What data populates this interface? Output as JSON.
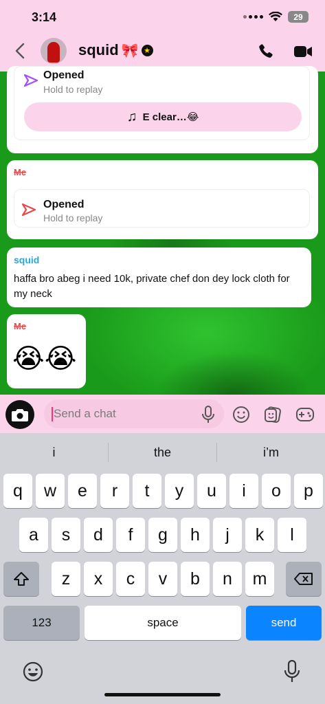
{
  "status_bar": {
    "time": "3:14",
    "battery": "29"
  },
  "header": {
    "contact_name": "squid",
    "name_emoji": "🎀"
  },
  "messages": [
    {
      "type": "snap",
      "status": "Opened",
      "subtitle": "Hold to replay",
      "music_label": "E clear…😂"
    },
    {
      "type": "snap",
      "sender": "Me",
      "status": "Opened",
      "subtitle": "Hold to replay"
    },
    {
      "type": "text",
      "sender": "squid",
      "text": "haffa bro abeg i need 10k, private chef don dey lock cloth for my neck"
    },
    {
      "type": "emoji",
      "sender": "Me",
      "text": "😭😭"
    }
  ],
  "input": {
    "placeholder": "Send a chat",
    "value": ""
  },
  "keyboard": {
    "suggestions": [
      "i",
      "the",
      "i’m"
    ],
    "row1": [
      "q",
      "w",
      "e",
      "r",
      "t",
      "y",
      "u",
      "i",
      "o",
      "p"
    ],
    "row2": [
      "a",
      "s",
      "d",
      "f",
      "g",
      "h",
      "j",
      "k",
      "l"
    ],
    "row3": [
      "z",
      "x",
      "c",
      "v",
      "b",
      "n",
      "m"
    ],
    "numbers_label": "123",
    "space_label": "space",
    "send_label": "send"
  },
  "colors": {
    "header_bg": "#fbd3ea",
    "me_label": "#e8484a",
    "friend_label": "#2aa7d8",
    "send_key": "#0a84ff",
    "snap_arrow_purple": "#a64dff",
    "snap_arrow_red": "#e8484a"
  }
}
